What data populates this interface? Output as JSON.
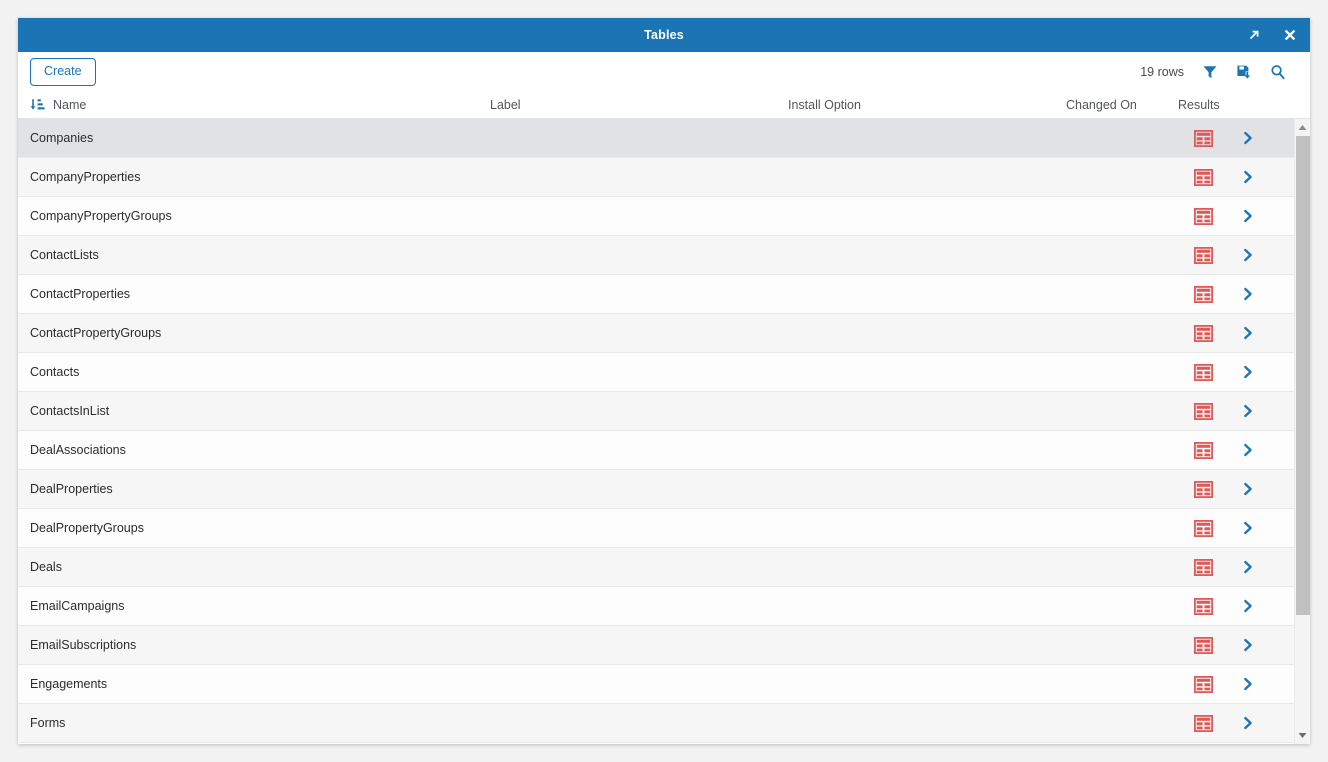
{
  "window": {
    "title": "Tables",
    "controls": [
      {
        "name": "maximize-icon",
        "label": "Maximize"
      },
      {
        "name": "close-icon",
        "label": "Close"
      }
    ]
  },
  "toolbar": {
    "create_label": "Create",
    "rows_count": "19 rows",
    "icons": [
      {
        "name": "filter-icon",
        "label": "Filter"
      },
      {
        "name": "save-icon",
        "label": "Save"
      },
      {
        "name": "search-icon",
        "label": "Search"
      }
    ]
  },
  "grid": {
    "sort_column": "Name",
    "sort_direction": "ascending",
    "columns": [
      {
        "key": "name",
        "label": "Name"
      },
      {
        "key": "label",
        "label": "Label"
      },
      {
        "key": "install",
        "label": "Install Option"
      },
      {
        "key": "changed",
        "label": "Changed On"
      },
      {
        "key": "results",
        "label": "Results"
      }
    ],
    "rows": [
      {
        "name": "Companies",
        "label": "",
        "install": "",
        "changed": "",
        "selected": true
      },
      {
        "name": "CompanyProperties",
        "label": "",
        "install": "",
        "changed": "",
        "selected": false
      },
      {
        "name": "CompanyPropertyGroups",
        "label": "",
        "install": "",
        "changed": "",
        "selected": false
      },
      {
        "name": "ContactLists",
        "label": "",
        "install": "",
        "changed": "",
        "selected": false
      },
      {
        "name": "ContactProperties",
        "label": "",
        "install": "",
        "changed": "",
        "selected": false
      },
      {
        "name": "ContactPropertyGroups",
        "label": "",
        "install": "",
        "changed": "",
        "selected": false
      },
      {
        "name": "Contacts",
        "label": "",
        "install": "",
        "changed": "",
        "selected": false
      },
      {
        "name": "ContactsInList",
        "label": "",
        "install": "",
        "changed": "",
        "selected": false
      },
      {
        "name": "DealAssociations",
        "label": "",
        "install": "",
        "changed": "",
        "selected": false
      },
      {
        "name": "DealProperties",
        "label": "",
        "install": "",
        "changed": "",
        "selected": false
      },
      {
        "name": "DealPropertyGroups",
        "label": "",
        "install": "",
        "changed": "",
        "selected": false
      },
      {
        "name": "Deals",
        "label": "",
        "install": "",
        "changed": "",
        "selected": false
      },
      {
        "name": "EmailCampaigns",
        "label": "",
        "install": "",
        "changed": "",
        "selected": false
      },
      {
        "name": "EmailSubscriptions",
        "label": "",
        "install": "",
        "changed": "",
        "selected": false
      },
      {
        "name": "Engagements",
        "label": "",
        "install": "",
        "changed": "",
        "selected": false
      },
      {
        "name": "Forms",
        "label": "",
        "install": "",
        "changed": "",
        "selected": false
      }
    ],
    "row_icons": {
      "grid": "table-grid-icon",
      "chevron": "chevron-right-icon"
    }
  },
  "scrollbar": {
    "up_icon": "scroll-up-arrow-icon",
    "down_icon": "scroll-down-arrow-icon",
    "thumb": "scrollbar-thumb"
  },
  "colors": {
    "titlebar": "#1b75b4",
    "accent": "#1b75b4",
    "grid_icon": "#dd5a5a",
    "row_selected": "#e0e2e5",
    "row_odd": "#fdfdfd",
    "row_even": "#f6f6f6"
  }
}
